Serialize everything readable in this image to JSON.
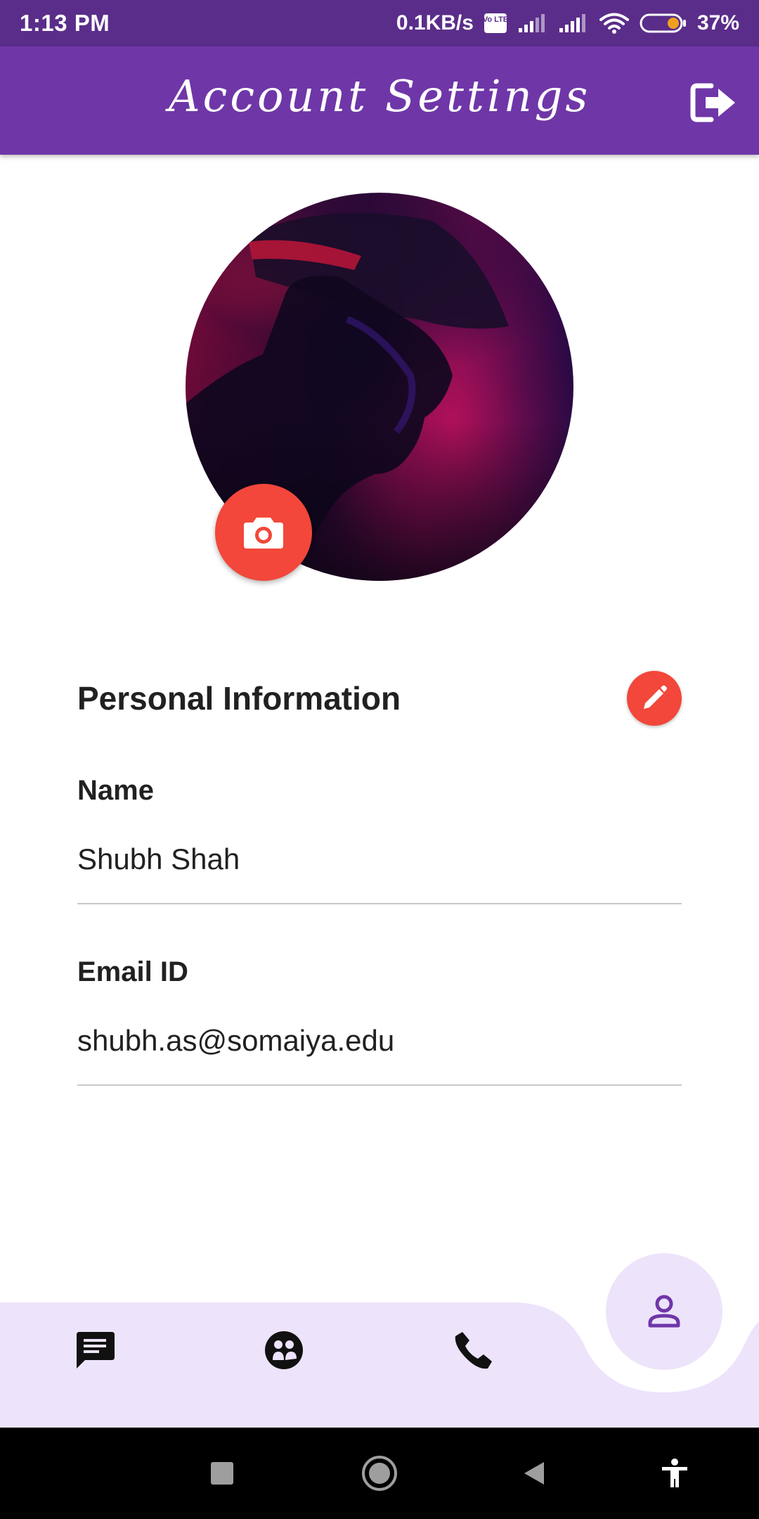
{
  "status_bar": {
    "time": "1:13 PM",
    "network_speed": "0.1KB/s",
    "volte_badge": "Vo LTE",
    "battery_percent": "37%",
    "battery_level": 0.37,
    "icons": [
      "volte-icon",
      "signal-icon",
      "signal-icon",
      "wifi-icon",
      "battery-icon"
    ]
  },
  "app_bar": {
    "title": "Account Settings",
    "logout_icon": "logout-icon"
  },
  "profile": {
    "avatar_icon": "profile-photo",
    "camera_icon": "camera-icon"
  },
  "personal_info": {
    "title": "Personal Information",
    "edit_icon": "pencil-icon",
    "fields": [
      {
        "label": "Name",
        "value": "Shubh Shah"
      },
      {
        "label": "Email ID",
        "value": "shubh.as@somaiya.edu"
      }
    ]
  },
  "bottom_nav": {
    "items": [
      {
        "icon": "chat-icon",
        "active": false
      },
      {
        "icon": "groups-icon",
        "active": false
      },
      {
        "icon": "phone-icon",
        "active": false
      },
      {
        "icon": "person-icon",
        "active": true
      }
    ]
  },
  "system_nav": {
    "items": [
      "recents-icon",
      "home-icon",
      "back-icon",
      "accessibility-icon"
    ]
  },
  "colors": {
    "status_bar": "#5a2d8a",
    "app_bar": "#6f36a8",
    "accent_red": "#f2473a",
    "nav_background": "#ede3fb",
    "active_icon": "#6f36a8"
  }
}
